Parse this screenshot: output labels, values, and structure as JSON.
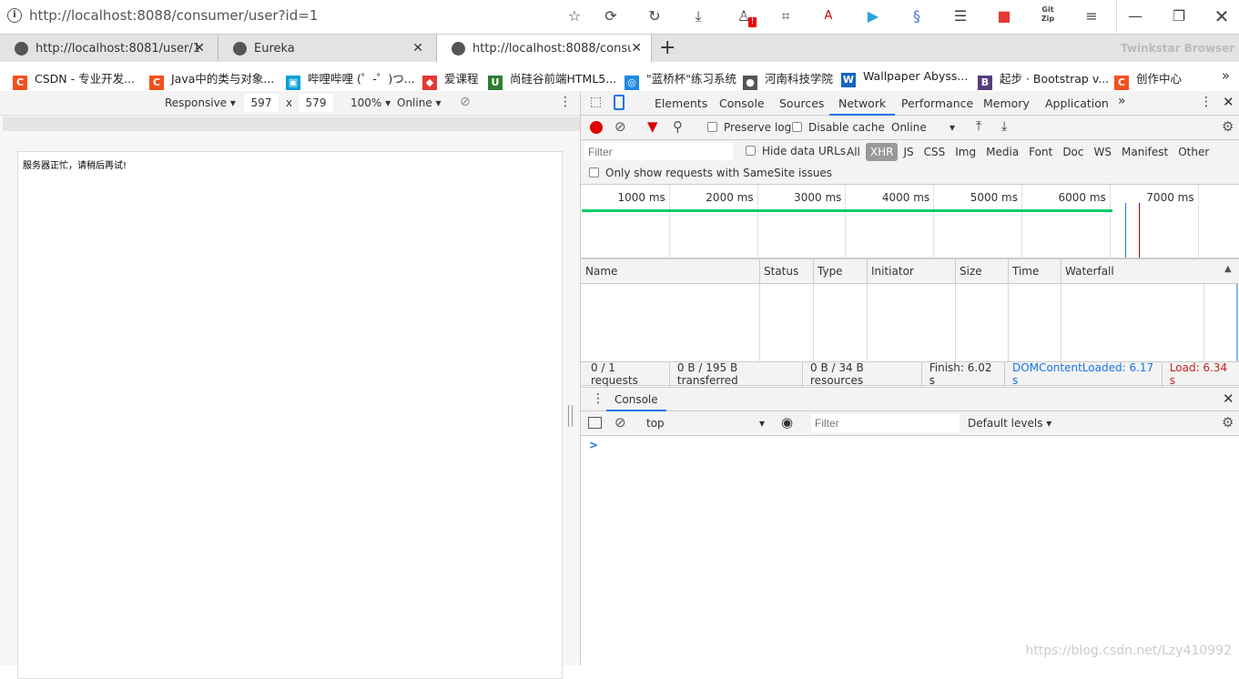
{
  "address_bar": {
    "url": "http://localhost:8088/consumer/user?id=1"
  },
  "toolbar_icons": [
    "star-icon",
    "refresh-icon",
    "undo-icon",
    "download-icon",
    "user-alert-icon",
    "crop-icon",
    "translate-icon",
    "video-icon",
    "extension-icon",
    "notes-icon",
    "dice-icon",
    "gitzip-icon",
    "menu-icon"
  ],
  "tabs": [
    {
      "label": "http://localhost:8081/user/1"
    },
    {
      "label": "Eureka"
    },
    {
      "label": "http://localhost:8088/consur",
      "active": true
    }
  ],
  "brand": "Twinkstar Browser",
  "bookmarks": [
    {
      "label": "CSDN - 专业开发...",
      "color": "#f4511e",
      "glyph": "C"
    },
    {
      "label": "Java中的类与对象...",
      "color": "#f4511e",
      "glyph": "C"
    },
    {
      "label": "哔哩哔哩 (゜-゜)つ...",
      "color": "#00a1d6",
      "glyph": "▣"
    },
    {
      "label": "爱课程",
      "color": "#e53935",
      "glyph": "◆"
    },
    {
      "label": "尚硅谷前端HTML5...",
      "color": "#2e7d32",
      "glyph": "U"
    },
    {
      "label": "\"蓝桥杯\"练习系统",
      "color": "#1e88e5",
      "glyph": "◎"
    },
    {
      "label": "河南科技学院",
      "color": "#555555",
      "glyph": "●"
    },
    {
      "label": "Wallpaper Abyss...",
      "color": "#1565c0",
      "glyph": "W"
    },
    {
      "label": "起步 · Bootstrap v...",
      "color": "#563d7c",
      "glyph": "B"
    },
    {
      "label": "创作中心",
      "color": "#f4511e",
      "glyph": "C"
    }
  ],
  "device_toolbar": {
    "mode": "Responsive",
    "width": "597",
    "height": "579",
    "times": "x",
    "zoom": "100%",
    "network": "Online"
  },
  "page": {
    "message": "服务器正忙，请稍后再试!"
  },
  "devtools": {
    "tabs": [
      "Elements",
      "Console",
      "Sources",
      "Network",
      "Performance",
      "Memory",
      "Application"
    ],
    "active_tab": "Network",
    "network_toolbar": {
      "preserve_log": "Preserve log",
      "disable_cache": "Disable cache",
      "throttle": "Online"
    },
    "filter": {
      "placeholder": "Filter",
      "hide_data_urls": "Hide data URLs",
      "types": [
        "All",
        "XHR",
        "JS",
        "CSS",
        "Img",
        "Media",
        "Font",
        "Doc",
        "WS",
        "Manifest",
        "Other"
      ],
      "active_type": "XHR",
      "samesite": "Only show requests with SameSite issues"
    },
    "overview_ticks": [
      "1000 ms",
      "2000 ms",
      "3000 ms",
      "4000 ms",
      "5000 ms",
      "6000 ms",
      "7000 ms"
    ],
    "columns": [
      "Name",
      "Status",
      "Type",
      "Initiator",
      "Size",
      "Time",
      "Waterfall"
    ],
    "status_bar": {
      "requests": "0 / 1 requests",
      "transferred": "0 B / 195 B transferred",
      "resources": "0 B / 34 B resources",
      "finish": "Finish: 6.02 s",
      "dcl": "DOMContentLoaded: 6.17 s",
      "load": "Load: 6.34 s"
    },
    "colors": {
      "dcl": "#1a73e8",
      "load": "#c5221f",
      "accent": "#1a73e8"
    },
    "drawer": {
      "tab": "Console",
      "context": "top",
      "filter_placeholder": "Filter",
      "levels": "Default levels",
      "prompt": ">"
    }
  },
  "watermark": "https://blog.csdn.net/Lzy410992"
}
